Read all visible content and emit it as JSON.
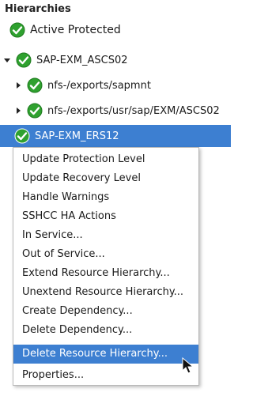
{
  "panel": {
    "title": "Hierarchies",
    "status_label": "Active Protected"
  },
  "tree": {
    "root": {
      "label": "SAP-EXM_ASCS02",
      "expanded": true
    },
    "children": [
      {
        "label": "nfs-/exports/sapmnt"
      },
      {
        "label": "nfs-/exports/usr/sap/EXM/ASCS02"
      }
    ],
    "selected": {
      "label": "SAP-EXM_ERS12"
    }
  },
  "context_menu": {
    "items": [
      "Update Protection Level",
      "Update Recovery Level",
      "Handle Warnings",
      "SSHCC HA Actions",
      "In Service...",
      "Out of Service...",
      "Extend Resource Hierarchy...",
      "Unextend Resource Hierarchy...",
      "Create Dependency...",
      "Delete Dependency...",
      "Delete Resource Hierarchy...",
      "Properties..."
    ],
    "highlighted_index": 10
  },
  "colors": {
    "selection": "#3d7fd1",
    "status_green": "#2fa12f"
  },
  "icons": {
    "status": "green-check-icon",
    "expand": "triangle-down-icon",
    "collapse": "triangle-right-icon",
    "pointer": "mouse-pointer-icon"
  }
}
